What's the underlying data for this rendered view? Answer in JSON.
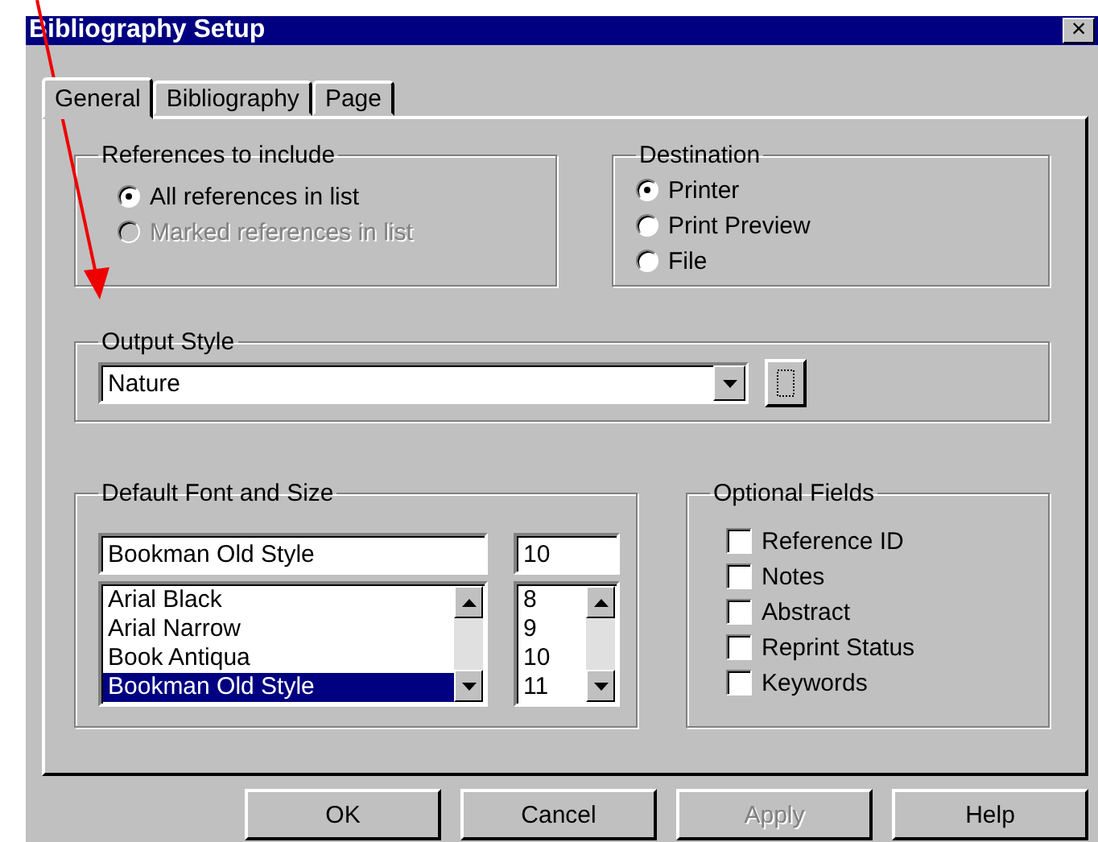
{
  "window": {
    "title": "Bibliography Setup",
    "close": "×"
  },
  "tabs": [
    {
      "label": "General",
      "selected": true
    },
    {
      "label": "Bibliography",
      "selected": false
    },
    {
      "label": "Page",
      "selected": false
    }
  ],
  "references": {
    "title": "References to include",
    "options": [
      {
        "label": "All references in list",
        "selected": true,
        "disabled": false
      },
      {
        "label": "Marked references in list",
        "selected": false,
        "disabled": true
      }
    ]
  },
  "destination": {
    "title": "Destination",
    "options": [
      {
        "label": "Printer",
        "selected": true,
        "disabled": false
      },
      {
        "label": "Print Preview",
        "selected": false,
        "disabled": false
      },
      {
        "label": "File",
        "selected": false,
        "disabled": false
      }
    ]
  },
  "output_style": {
    "title": "Output Style",
    "value": "Nature"
  },
  "font": {
    "title": "Default Font and Size",
    "font_value": "Bookman Old Style",
    "size_value": "10",
    "fonts": [
      {
        "label": "Arial Black",
        "selected": false
      },
      {
        "label": "Arial Narrow",
        "selected": false
      },
      {
        "label": "Book Antiqua",
        "selected": false
      },
      {
        "label": "Bookman Old Style",
        "selected": true
      }
    ],
    "sizes": [
      {
        "label": "8",
        "selected": false
      },
      {
        "label": "9",
        "selected": false
      },
      {
        "label": "10",
        "selected": false
      },
      {
        "label": "11",
        "selected": false
      }
    ]
  },
  "optional_fields": {
    "title": "Optional Fields",
    "items": [
      {
        "label": "Reference ID",
        "checked": false
      },
      {
        "label": "Notes",
        "checked": false
      },
      {
        "label": "Abstract",
        "checked": false
      },
      {
        "label": "Reprint Status",
        "checked": false
      },
      {
        "label": "Keywords",
        "checked": false
      }
    ]
  },
  "buttons": [
    {
      "label": "OK",
      "disabled": false
    },
    {
      "label": "Cancel",
      "disabled": false
    },
    {
      "label": "Apply",
      "disabled": true
    },
    {
      "label": "Help",
      "disabled": false
    }
  ]
}
